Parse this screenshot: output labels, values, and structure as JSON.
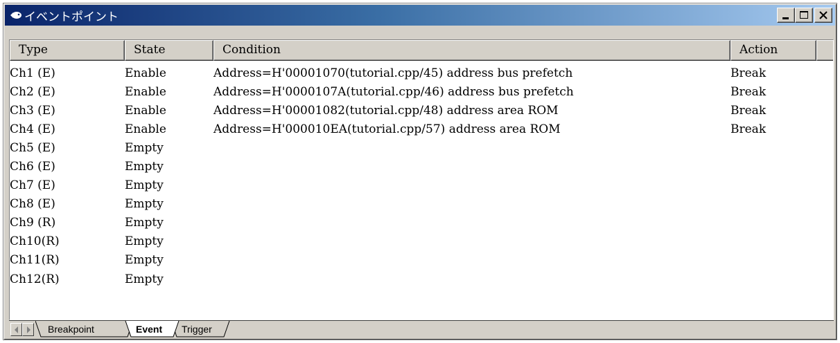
{
  "window": {
    "title": "イベントポイント",
    "icon": "event-point-icon",
    "buttons": [
      "minimize",
      "maximize",
      "close"
    ]
  },
  "table": {
    "columns": [
      "Type",
      "State",
      "Condition",
      "Action"
    ],
    "rows": [
      {
        "type": "Ch1 (E)",
        "state": "Enable",
        "condition": "Address=H'00001070(tutorial.cpp/45) address bus prefetch",
        "action": "Break"
      },
      {
        "type": "Ch2 (E)",
        "state": "Enable",
        "condition": "Address=H'0000107A(tutorial.cpp/46) address bus prefetch",
        "action": "Break"
      },
      {
        "type": "Ch3 (E)",
        "state": "Enable",
        "condition": "Address=H'00001082(tutorial.cpp/48) address area ROM",
        "action": "Break"
      },
      {
        "type": "Ch4 (E)",
        "state": "Enable",
        "condition": "Address=H'000010EA(tutorial.cpp/57) address area ROM",
        "action": "Break"
      },
      {
        "type": "Ch5 (E)",
        "state": "Empty",
        "condition": "",
        "action": ""
      },
      {
        "type": "Ch6 (E)",
        "state": "Empty",
        "condition": "",
        "action": ""
      },
      {
        "type": "Ch7 (E)",
        "state": "Empty",
        "condition": "",
        "action": ""
      },
      {
        "type": "Ch8 (E)",
        "state": "Empty",
        "condition": "",
        "action": ""
      },
      {
        "type": "Ch9 (R)",
        "state": "Empty",
        "condition": "",
        "action": ""
      },
      {
        "type": "Ch10(R)",
        "state": "Empty",
        "condition": "",
        "action": ""
      },
      {
        "type": "Ch11(R)",
        "state": "Empty",
        "condition": "",
        "action": ""
      },
      {
        "type": "Ch12(R)",
        "state": "Empty",
        "condition": "",
        "action": ""
      }
    ]
  },
  "tabs": [
    {
      "label": "Breakpoint",
      "active": false
    },
    {
      "label": "Event",
      "active": true
    },
    {
      "label": "Trigger",
      "active": false
    }
  ],
  "colors": {
    "titlebar_start": "#0a246a",
    "titlebar_end": "#a6caf0",
    "face": "#d4d0c8"
  }
}
